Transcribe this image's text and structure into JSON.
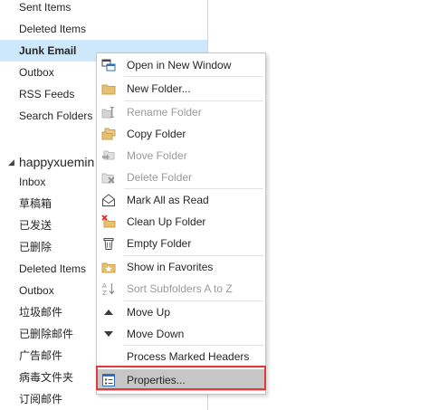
{
  "folder_pane": {
    "top_items": [
      {
        "label": "Sent Items"
      },
      {
        "label": "Deleted Items"
      },
      {
        "label": "Junk Email",
        "selected": true
      },
      {
        "label": "Outbox"
      },
      {
        "label": "RSS Feeds"
      },
      {
        "label": "Search Folders"
      }
    ],
    "account": {
      "name": "happyxuemin",
      "expanded": true
    },
    "account_items": [
      {
        "label": "Inbox"
      },
      {
        "label": "草稿箱"
      },
      {
        "label": "已发送"
      },
      {
        "label": "已删除"
      },
      {
        "label": "Deleted Items"
      },
      {
        "label": "Outbox"
      },
      {
        "label": "垃圾邮件"
      },
      {
        "label": "已删除邮件"
      },
      {
        "label": "广告邮件"
      },
      {
        "label": "病毒文件夹"
      },
      {
        "label": "订阅邮件"
      }
    ]
  },
  "context_menu": {
    "items": [
      {
        "label": "Open in New Window",
        "icon": "open-new-window-icon",
        "enabled": true
      },
      {
        "label": "New Folder...",
        "icon": "new-folder-icon",
        "enabled": true
      },
      {
        "label": "Rename Folder",
        "icon": "rename-folder-icon",
        "enabled": false
      },
      {
        "label": "Copy Folder",
        "icon": "copy-folder-icon",
        "enabled": true
      },
      {
        "label": "Move Folder",
        "icon": "move-folder-icon",
        "enabled": false
      },
      {
        "label": "Delete Folder",
        "icon": "delete-folder-icon",
        "enabled": false
      },
      {
        "label": "Mark All as Read",
        "icon": "mark-all-read-icon",
        "enabled": true
      },
      {
        "label": "Clean Up Folder",
        "icon": "clean-up-folder-icon",
        "enabled": true
      },
      {
        "label": "Empty Folder",
        "icon": "empty-folder-icon",
        "enabled": true
      },
      {
        "label": "Show in Favorites",
        "icon": "favorites-folder-icon",
        "enabled": true
      },
      {
        "label": "Sort Subfolders A to Z",
        "icon": "sort-az-icon",
        "enabled": false
      },
      {
        "label": "Move Up",
        "icon": "move-up-icon",
        "enabled": true
      },
      {
        "label": "Move Down",
        "icon": "move-down-icon",
        "enabled": true
      },
      {
        "label": "Process Marked Headers",
        "icon": "",
        "enabled": true
      },
      {
        "label": "Properties...",
        "icon": "properties-icon",
        "enabled": true,
        "highlighted": true
      }
    ]
  },
  "colors": {
    "selected_folder_bg": "#cde8fb",
    "menu_highlight_bg": "#c6c6c6",
    "annotation_border": "#e03a3e",
    "disabled_text": "#9a9a9a"
  }
}
